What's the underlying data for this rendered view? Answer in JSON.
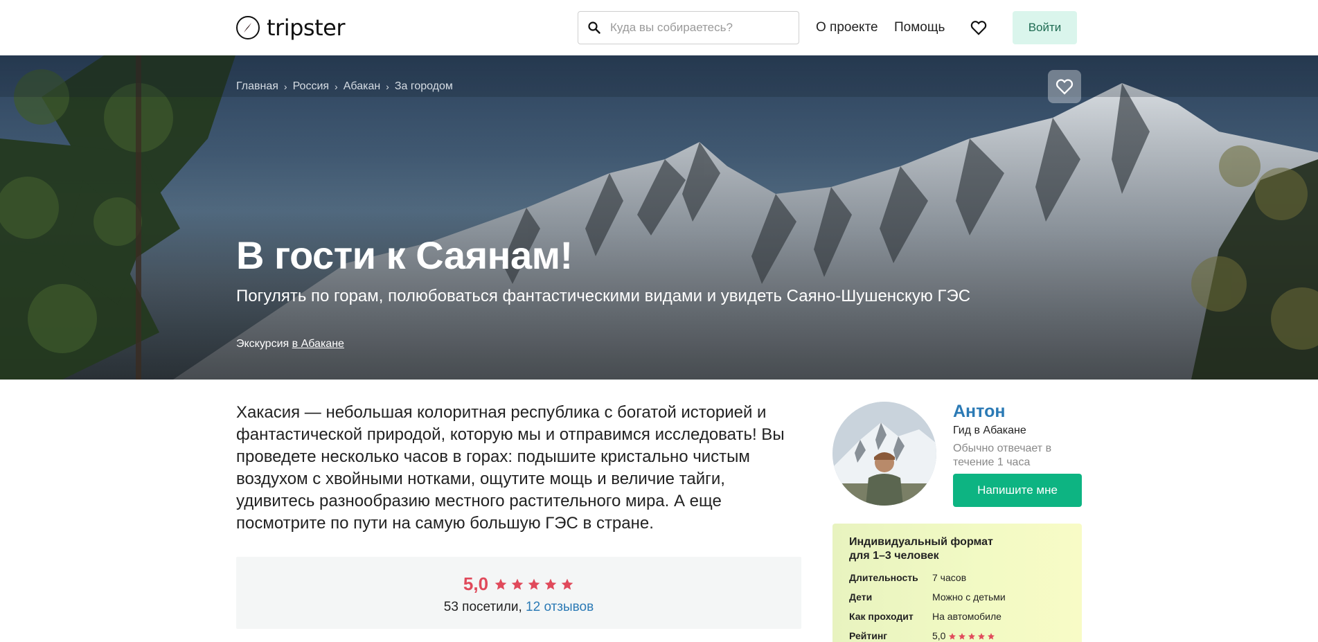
{
  "header": {
    "logo_text": "tripster",
    "search_placeholder": "Куда вы собираетесь?",
    "nav": [
      "О проекте",
      "Помощь"
    ],
    "login_label": "Войти"
  },
  "hero": {
    "breadcrumbs": [
      "Главная",
      "Россия",
      "Абакан",
      "За городом"
    ],
    "title": "В гости к Саянам!",
    "subtitle": "Погулять по горам, полюбоваться фантастическими видами и увидеть Саяно-Шушенскую ГЭС",
    "type_prefix": "Экскурсия",
    "type_link": "в Абакане"
  },
  "description": "Хакасия — небольшая колоритная республика с богатой историей и фантастической природой, которую мы и отправимся исследовать! Вы проведете несколько часов в горах: подышите кристально чистым воздухом с хвойными нотками, ощутите мощь и величие тайги, удивитесь разнообразию местного растительного мира. А еще посмотрите по пути на самую большую ГЭС в стране.",
  "rating": {
    "value": "5,0",
    "stars": 5,
    "visitors_text": "53 посетили,",
    "reviews_link": "12 отзывов"
  },
  "guide": {
    "name": "Антон",
    "role": "Гид в Абакане",
    "response": "Обычно отвечает в течение 1 часа",
    "write_label": "Напишите мне"
  },
  "format": {
    "title": "Индивидуальный формат для 1–3 человек",
    "rows": [
      {
        "key": "Длительность",
        "value": "7 часов"
      },
      {
        "key": "Дети",
        "value": "Можно с детьми"
      },
      {
        "key": "Как проходит",
        "value": "На автомобиле"
      },
      {
        "key": "Рейтинг",
        "value": "5,0"
      }
    ]
  },
  "colors": {
    "accent_green": "#0db482",
    "link_blue": "#2b7ab5",
    "rating_red": "#e04a5b",
    "login_bg": "#daf5ec"
  }
}
